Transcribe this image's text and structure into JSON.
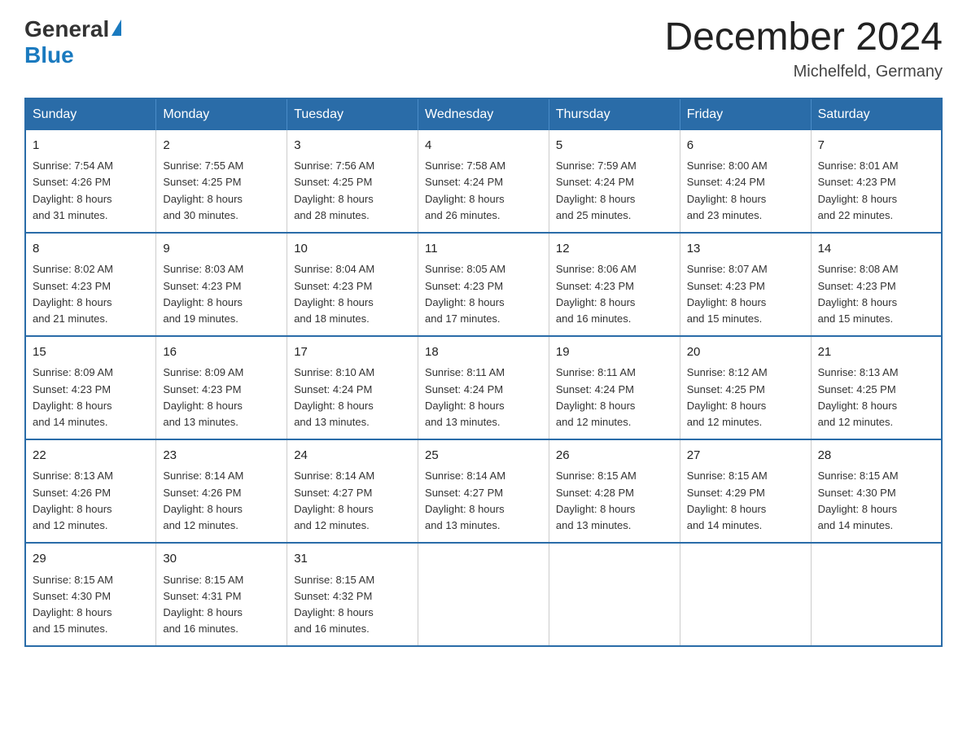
{
  "header": {
    "logo_general": "General",
    "logo_blue": "Blue",
    "title": "December 2024",
    "subtitle": "Michelfeld, Germany"
  },
  "days_of_week": [
    "Sunday",
    "Monday",
    "Tuesday",
    "Wednesday",
    "Thursday",
    "Friday",
    "Saturday"
  ],
  "weeks": [
    [
      {
        "day": "1",
        "sunrise": "7:54 AM",
        "sunset": "4:26 PM",
        "daylight": "8 hours and 31 minutes."
      },
      {
        "day": "2",
        "sunrise": "7:55 AM",
        "sunset": "4:25 PM",
        "daylight": "8 hours and 30 minutes."
      },
      {
        "day": "3",
        "sunrise": "7:56 AM",
        "sunset": "4:25 PM",
        "daylight": "8 hours and 28 minutes."
      },
      {
        "day": "4",
        "sunrise": "7:58 AM",
        "sunset": "4:24 PM",
        "daylight": "8 hours and 26 minutes."
      },
      {
        "day": "5",
        "sunrise": "7:59 AM",
        "sunset": "4:24 PM",
        "daylight": "8 hours and 25 minutes."
      },
      {
        "day": "6",
        "sunrise": "8:00 AM",
        "sunset": "4:24 PM",
        "daylight": "8 hours and 23 minutes."
      },
      {
        "day": "7",
        "sunrise": "8:01 AM",
        "sunset": "4:23 PM",
        "daylight": "8 hours and 22 minutes."
      }
    ],
    [
      {
        "day": "8",
        "sunrise": "8:02 AM",
        "sunset": "4:23 PM",
        "daylight": "8 hours and 21 minutes."
      },
      {
        "day": "9",
        "sunrise": "8:03 AM",
        "sunset": "4:23 PM",
        "daylight": "8 hours and 19 minutes."
      },
      {
        "day": "10",
        "sunrise": "8:04 AM",
        "sunset": "4:23 PM",
        "daylight": "8 hours and 18 minutes."
      },
      {
        "day": "11",
        "sunrise": "8:05 AM",
        "sunset": "4:23 PM",
        "daylight": "8 hours and 17 minutes."
      },
      {
        "day": "12",
        "sunrise": "8:06 AM",
        "sunset": "4:23 PM",
        "daylight": "8 hours and 16 minutes."
      },
      {
        "day": "13",
        "sunrise": "8:07 AM",
        "sunset": "4:23 PM",
        "daylight": "8 hours and 15 minutes."
      },
      {
        "day": "14",
        "sunrise": "8:08 AM",
        "sunset": "4:23 PM",
        "daylight": "8 hours and 15 minutes."
      }
    ],
    [
      {
        "day": "15",
        "sunrise": "8:09 AM",
        "sunset": "4:23 PM",
        "daylight": "8 hours and 14 minutes."
      },
      {
        "day": "16",
        "sunrise": "8:09 AM",
        "sunset": "4:23 PM",
        "daylight": "8 hours and 13 minutes."
      },
      {
        "day": "17",
        "sunrise": "8:10 AM",
        "sunset": "4:24 PM",
        "daylight": "8 hours and 13 minutes."
      },
      {
        "day": "18",
        "sunrise": "8:11 AM",
        "sunset": "4:24 PM",
        "daylight": "8 hours and 13 minutes."
      },
      {
        "day": "19",
        "sunrise": "8:11 AM",
        "sunset": "4:24 PM",
        "daylight": "8 hours and 12 minutes."
      },
      {
        "day": "20",
        "sunrise": "8:12 AM",
        "sunset": "4:25 PM",
        "daylight": "8 hours and 12 minutes."
      },
      {
        "day": "21",
        "sunrise": "8:13 AM",
        "sunset": "4:25 PM",
        "daylight": "8 hours and 12 minutes."
      }
    ],
    [
      {
        "day": "22",
        "sunrise": "8:13 AM",
        "sunset": "4:26 PM",
        "daylight": "8 hours and 12 minutes."
      },
      {
        "day": "23",
        "sunrise": "8:14 AM",
        "sunset": "4:26 PM",
        "daylight": "8 hours and 12 minutes."
      },
      {
        "day": "24",
        "sunrise": "8:14 AM",
        "sunset": "4:27 PM",
        "daylight": "8 hours and 12 minutes."
      },
      {
        "day": "25",
        "sunrise": "8:14 AM",
        "sunset": "4:27 PM",
        "daylight": "8 hours and 13 minutes."
      },
      {
        "day": "26",
        "sunrise": "8:15 AM",
        "sunset": "4:28 PM",
        "daylight": "8 hours and 13 minutes."
      },
      {
        "day": "27",
        "sunrise": "8:15 AM",
        "sunset": "4:29 PM",
        "daylight": "8 hours and 14 minutes."
      },
      {
        "day": "28",
        "sunrise": "8:15 AM",
        "sunset": "4:30 PM",
        "daylight": "8 hours and 14 minutes."
      }
    ],
    [
      {
        "day": "29",
        "sunrise": "8:15 AM",
        "sunset": "4:30 PM",
        "daylight": "8 hours and 15 minutes."
      },
      {
        "day": "30",
        "sunrise": "8:15 AM",
        "sunset": "4:31 PM",
        "daylight": "8 hours and 16 minutes."
      },
      {
        "day": "31",
        "sunrise": "8:15 AM",
        "sunset": "4:32 PM",
        "daylight": "8 hours and 16 minutes."
      },
      null,
      null,
      null,
      null
    ]
  ],
  "labels": {
    "sunrise": "Sunrise:",
    "sunset": "Sunset:",
    "daylight": "Daylight:"
  }
}
